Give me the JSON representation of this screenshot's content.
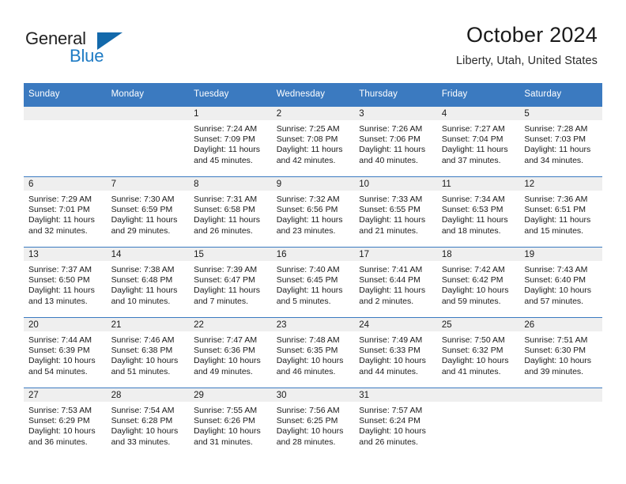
{
  "brand": {
    "name_part1": "General",
    "name_part2": "Blue",
    "triangle_icon": "triangle-icon",
    "accent_color": "#1e7bc4",
    "dark_color": "#1369ab"
  },
  "header": {
    "month_title": "October 2024",
    "location": "Liberty, Utah, United States",
    "header_color": "#3b7ac0"
  },
  "weekday_headers": [
    "Sunday",
    "Monday",
    "Tuesday",
    "Wednesday",
    "Thursday",
    "Friday",
    "Saturday"
  ],
  "weeks": [
    [
      {
        "empty": true
      },
      {
        "empty": true
      },
      {
        "day": "1",
        "sunrise": "Sunrise: 7:24 AM",
        "sunset": "Sunset: 7:09 PM",
        "daylight": "Daylight: 11 hours and 45 minutes."
      },
      {
        "day": "2",
        "sunrise": "Sunrise: 7:25 AM",
        "sunset": "Sunset: 7:08 PM",
        "daylight": "Daylight: 11 hours and 42 minutes."
      },
      {
        "day": "3",
        "sunrise": "Sunrise: 7:26 AM",
        "sunset": "Sunset: 7:06 PM",
        "daylight": "Daylight: 11 hours and 40 minutes."
      },
      {
        "day": "4",
        "sunrise": "Sunrise: 7:27 AM",
        "sunset": "Sunset: 7:04 PM",
        "daylight": "Daylight: 11 hours and 37 minutes."
      },
      {
        "day": "5",
        "sunrise": "Sunrise: 7:28 AM",
        "sunset": "Sunset: 7:03 PM",
        "daylight": "Daylight: 11 hours and 34 minutes."
      }
    ],
    [
      {
        "day": "6",
        "sunrise": "Sunrise: 7:29 AM",
        "sunset": "Sunset: 7:01 PM",
        "daylight": "Daylight: 11 hours and 32 minutes."
      },
      {
        "day": "7",
        "sunrise": "Sunrise: 7:30 AM",
        "sunset": "Sunset: 6:59 PM",
        "daylight": "Daylight: 11 hours and 29 minutes."
      },
      {
        "day": "8",
        "sunrise": "Sunrise: 7:31 AM",
        "sunset": "Sunset: 6:58 PM",
        "daylight": "Daylight: 11 hours and 26 minutes."
      },
      {
        "day": "9",
        "sunrise": "Sunrise: 7:32 AM",
        "sunset": "Sunset: 6:56 PM",
        "daylight": "Daylight: 11 hours and 23 minutes."
      },
      {
        "day": "10",
        "sunrise": "Sunrise: 7:33 AM",
        "sunset": "Sunset: 6:55 PM",
        "daylight": "Daylight: 11 hours and 21 minutes."
      },
      {
        "day": "11",
        "sunrise": "Sunrise: 7:34 AM",
        "sunset": "Sunset: 6:53 PM",
        "daylight": "Daylight: 11 hours and 18 minutes."
      },
      {
        "day": "12",
        "sunrise": "Sunrise: 7:36 AM",
        "sunset": "Sunset: 6:51 PM",
        "daylight": "Daylight: 11 hours and 15 minutes."
      }
    ],
    [
      {
        "day": "13",
        "sunrise": "Sunrise: 7:37 AM",
        "sunset": "Sunset: 6:50 PM",
        "daylight": "Daylight: 11 hours and 13 minutes."
      },
      {
        "day": "14",
        "sunrise": "Sunrise: 7:38 AM",
        "sunset": "Sunset: 6:48 PM",
        "daylight": "Daylight: 11 hours and 10 minutes."
      },
      {
        "day": "15",
        "sunrise": "Sunrise: 7:39 AM",
        "sunset": "Sunset: 6:47 PM",
        "daylight": "Daylight: 11 hours and 7 minutes."
      },
      {
        "day": "16",
        "sunrise": "Sunrise: 7:40 AM",
        "sunset": "Sunset: 6:45 PM",
        "daylight": "Daylight: 11 hours and 5 minutes."
      },
      {
        "day": "17",
        "sunrise": "Sunrise: 7:41 AM",
        "sunset": "Sunset: 6:44 PM",
        "daylight": "Daylight: 11 hours and 2 minutes."
      },
      {
        "day": "18",
        "sunrise": "Sunrise: 7:42 AM",
        "sunset": "Sunset: 6:42 PM",
        "daylight": "Daylight: 10 hours and 59 minutes."
      },
      {
        "day": "19",
        "sunrise": "Sunrise: 7:43 AM",
        "sunset": "Sunset: 6:40 PM",
        "daylight": "Daylight: 10 hours and 57 minutes."
      }
    ],
    [
      {
        "day": "20",
        "sunrise": "Sunrise: 7:44 AM",
        "sunset": "Sunset: 6:39 PM",
        "daylight": "Daylight: 10 hours and 54 minutes."
      },
      {
        "day": "21",
        "sunrise": "Sunrise: 7:46 AM",
        "sunset": "Sunset: 6:38 PM",
        "daylight": "Daylight: 10 hours and 51 minutes."
      },
      {
        "day": "22",
        "sunrise": "Sunrise: 7:47 AM",
        "sunset": "Sunset: 6:36 PM",
        "daylight": "Daylight: 10 hours and 49 minutes."
      },
      {
        "day": "23",
        "sunrise": "Sunrise: 7:48 AM",
        "sunset": "Sunset: 6:35 PM",
        "daylight": "Daylight: 10 hours and 46 minutes."
      },
      {
        "day": "24",
        "sunrise": "Sunrise: 7:49 AM",
        "sunset": "Sunset: 6:33 PM",
        "daylight": "Daylight: 10 hours and 44 minutes."
      },
      {
        "day": "25",
        "sunrise": "Sunrise: 7:50 AM",
        "sunset": "Sunset: 6:32 PM",
        "daylight": "Daylight: 10 hours and 41 minutes."
      },
      {
        "day": "26",
        "sunrise": "Sunrise: 7:51 AM",
        "sunset": "Sunset: 6:30 PM",
        "daylight": "Daylight: 10 hours and 39 minutes."
      }
    ],
    [
      {
        "day": "27",
        "sunrise": "Sunrise: 7:53 AM",
        "sunset": "Sunset: 6:29 PM",
        "daylight": "Daylight: 10 hours and 36 minutes."
      },
      {
        "day": "28",
        "sunrise": "Sunrise: 7:54 AM",
        "sunset": "Sunset: 6:28 PM",
        "daylight": "Daylight: 10 hours and 33 minutes."
      },
      {
        "day": "29",
        "sunrise": "Sunrise: 7:55 AM",
        "sunset": "Sunset: 6:26 PM",
        "daylight": "Daylight: 10 hours and 31 minutes."
      },
      {
        "day": "30",
        "sunrise": "Sunrise: 7:56 AM",
        "sunset": "Sunset: 6:25 PM",
        "daylight": "Daylight: 10 hours and 28 minutes."
      },
      {
        "day": "31",
        "sunrise": "Sunrise: 7:57 AM",
        "sunset": "Sunset: 6:24 PM",
        "daylight": "Daylight: 10 hours and 26 minutes."
      },
      {
        "empty": true
      },
      {
        "empty": true
      }
    ]
  ]
}
